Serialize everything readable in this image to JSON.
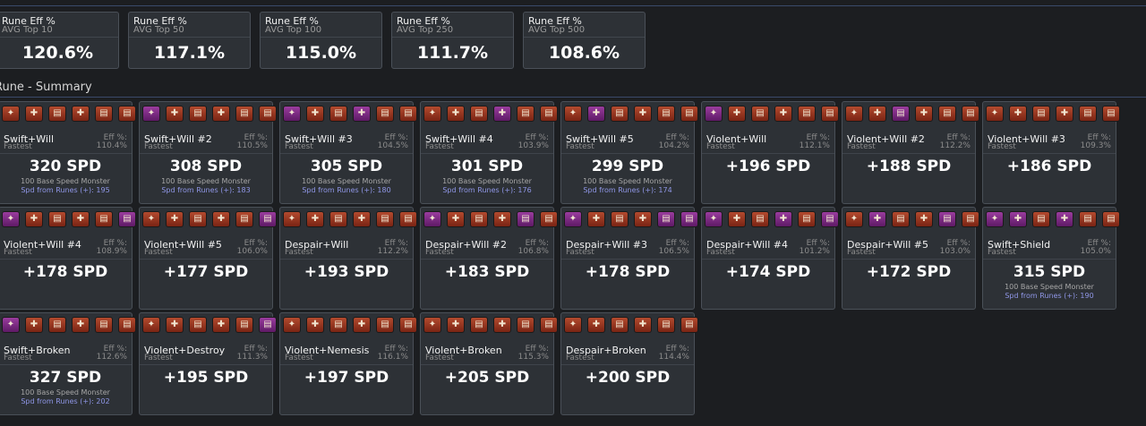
{
  "avg": [
    {
      "title": "Rune Eff %",
      "sub": "AVG Top 10",
      "value": "120.6%"
    },
    {
      "title": "Rune Eff %",
      "sub": "AVG Top 50",
      "value": "117.1%"
    },
    {
      "title": "Rune Eff %",
      "sub": "AVG Top 100",
      "value": "115.0%"
    },
    {
      "title": "Rune Eff %",
      "sub": "AVG Top 250",
      "value": "111.7%"
    },
    {
      "title": "Rune Eff %",
      "sub": "AVG Top 500",
      "value": "108.6%"
    }
  ],
  "section": {
    "title": "Rune - Summary"
  },
  "labels": {
    "fastest": "Fastest",
    "eff": "Eff %:",
    "base": "100 Base Speed Monster"
  },
  "cards": [
    {
      "name": "Swift+Will",
      "eff": "110.4%",
      "spd": "320 SPD",
      "from": "Spd from Runes (+): 195",
      "runes": [
        "red",
        "red",
        "red",
        "red",
        "red",
        "red"
      ]
    },
    {
      "name": "Swift+Will #2",
      "eff": "110.5%",
      "spd": "308 SPD",
      "from": "Spd from Runes (+): 183",
      "runes": [
        "purple",
        "red",
        "red",
        "red",
        "red",
        "red"
      ]
    },
    {
      "name": "Swift+Will #3",
      "eff": "104.5%",
      "spd": "305 SPD",
      "from": "Spd from Runes (+): 180",
      "runes": [
        "purple",
        "red",
        "red",
        "purple",
        "red",
        "red"
      ]
    },
    {
      "name": "Swift+Will #4",
      "eff": "103.9%",
      "spd": "301 SPD",
      "from": "Spd from Runes (+): 176",
      "runes": [
        "red",
        "red",
        "red",
        "purple",
        "red",
        "red"
      ]
    },
    {
      "name": "Swift+Will #5",
      "eff": "104.2%",
      "spd": "299 SPD",
      "from": "Spd from Runes (+): 174",
      "runes": [
        "red",
        "purple",
        "red",
        "red",
        "red",
        "red"
      ]
    },
    {
      "name": "Violent+Will",
      "eff": "112.1%",
      "spd": "+196 SPD",
      "from": "",
      "runes": [
        "purple",
        "red",
        "red",
        "red",
        "red",
        "red"
      ]
    },
    {
      "name": "Violent+Will #2",
      "eff": "112.2%",
      "spd": "+188 SPD",
      "from": "",
      "runes": [
        "red",
        "red",
        "purple",
        "red",
        "red",
        "red"
      ]
    },
    {
      "name": "Violent+Will #3",
      "eff": "109.3%",
      "spd": "+186 SPD",
      "from": "",
      "runes": [
        "red",
        "red",
        "red",
        "red",
        "red",
        "red"
      ]
    },
    {
      "name": "Violent+Will #4",
      "eff": "108.9%",
      "spd": "+178 SPD",
      "from": "",
      "runes": [
        "purple",
        "red",
        "red",
        "red",
        "red",
        "purple"
      ]
    },
    {
      "name": "Violent+Will #5",
      "eff": "106.0%",
      "spd": "+177 SPD",
      "from": "",
      "runes": [
        "red",
        "red",
        "red",
        "red",
        "red",
        "purple"
      ]
    },
    {
      "name": "Despair+Will",
      "eff": "112.2%",
      "spd": "+193 SPD",
      "from": "",
      "runes": [
        "red",
        "red",
        "red",
        "red",
        "red",
        "red"
      ]
    },
    {
      "name": "Despair+Will #2",
      "eff": "106.8%",
      "spd": "+183 SPD",
      "from": "",
      "runes": [
        "purple",
        "red",
        "red",
        "red",
        "purple",
        "red"
      ]
    },
    {
      "name": "Despair+Will #3",
      "eff": "106.5%",
      "spd": "+178 SPD",
      "from": "",
      "runes": [
        "purple",
        "red",
        "red",
        "red",
        "purple",
        "purple"
      ]
    },
    {
      "name": "Despair+Will #4",
      "eff": "101.2%",
      "spd": "+174 SPD",
      "from": "",
      "runes": [
        "purple",
        "red",
        "red",
        "purple",
        "red",
        "purple"
      ]
    },
    {
      "name": "Despair+Will #5",
      "eff": "103.0%",
      "spd": "+172 SPD",
      "from": "",
      "runes": [
        "red",
        "purple",
        "red",
        "red",
        "purple",
        "red"
      ]
    },
    {
      "name": "Swift+Shield",
      "eff": "105.0%",
      "spd": "315 SPD",
      "from": "Spd from Runes (+): 190",
      "runes": [
        "purple",
        "purple",
        "red",
        "purple",
        "red",
        "red"
      ]
    },
    {
      "name": "Swift+Broken",
      "eff": "112.6%",
      "spd": "327 SPD",
      "from": "Spd from Runes (+): 202",
      "runes": [
        "purple",
        "red",
        "red",
        "red",
        "red",
        "red"
      ]
    },
    {
      "name": "Violent+Destroy",
      "eff": "111.3%",
      "spd": "+195 SPD",
      "from": "",
      "runes": [
        "red",
        "red",
        "red",
        "red",
        "red",
        "purple"
      ]
    },
    {
      "name": "Violent+Nemesis",
      "eff": "116.1%",
      "spd": "+197 SPD",
      "from": "",
      "runes": [
        "red",
        "red",
        "red",
        "red",
        "red",
        "red"
      ]
    },
    {
      "name": "Violent+Broken",
      "eff": "115.3%",
      "spd": "+205 SPD",
      "from": "",
      "runes": [
        "red",
        "red",
        "red",
        "red",
        "red",
        "red"
      ]
    },
    {
      "name": "Despair+Broken",
      "eff": "114.4%",
      "spd": "+200 SPD",
      "from": "",
      "runes": [
        "red",
        "red",
        "red",
        "red",
        "red",
        "red"
      ]
    }
  ]
}
